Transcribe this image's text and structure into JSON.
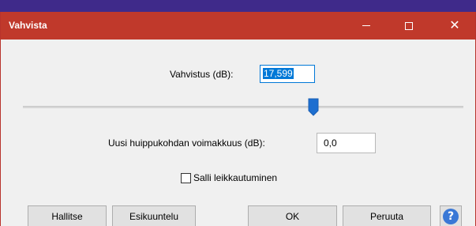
{
  "window": {
    "title": "Vahvista",
    "controls": {
      "minimize": "–",
      "maximize": "□",
      "close": "✕"
    },
    "titlebar_color": "#c0392b"
  },
  "gain": {
    "label": "Vahvistus (dB):",
    "value": "17,599"
  },
  "slider": {
    "value_fraction": 0.66
  },
  "peak": {
    "label": "Uusi huippukohdan voimakkuus (dB):",
    "value": "0,0"
  },
  "clipping": {
    "label": "Salli leikkautuminen",
    "checked": false
  },
  "buttons": {
    "manage": "Hallitse",
    "preview": "Esikuuntelu",
    "ok": "OK",
    "cancel": "Peruuta",
    "help": "?"
  },
  "icons": {
    "help": "help-icon",
    "minimize": "minimize-icon",
    "maximize": "maximize-icon",
    "close": "close-icon"
  }
}
